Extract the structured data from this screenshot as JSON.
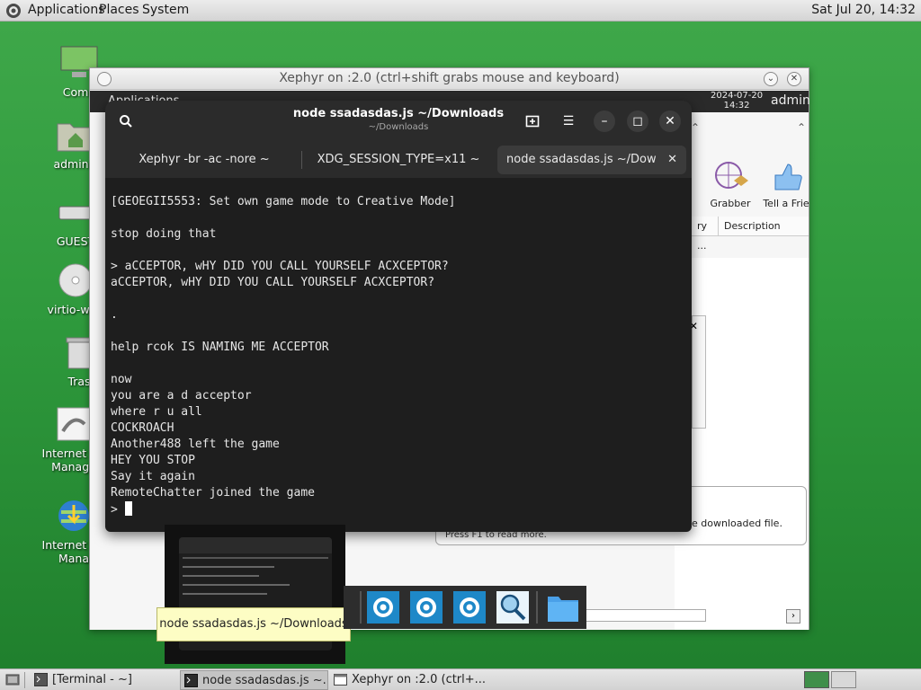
{
  "top_panel": {
    "menus": [
      "Applications",
      "Places",
      "System"
    ],
    "clock": "Sat Jul 20, 14:32"
  },
  "desktop_icons": [
    {
      "label": "Comp"
    },
    {
      "label": "admin's"
    },
    {
      "label": "GUEST"
    },
    {
      "label": "virtio-win-"
    },
    {
      "label": "Tras"
    },
    {
      "label": "Internet Do\nManage"
    },
    {
      "label": "Internet Do\nMana"
    }
  ],
  "xephyr": {
    "title": "Xephyr on :2.0 (ctrl+shift grabs mouse and keyboard)",
    "inner_panel": {
      "applications": "Applications",
      "clock_date": "2024-07-20",
      "clock_time": "14:32",
      "user": "admin"
    },
    "toolbar": {
      "grabber": "Grabber",
      "tell_friend": "Tell a Frie"
    },
    "columns": [
      "ry ...",
      "Description"
    ],
    "status_text": "e downloaded file.",
    "hint_text": "Press F1 to read more."
  },
  "terminal": {
    "title": "node ssadasdas.js ~/Downloads",
    "subtitle": "~/Downloads",
    "tabs": [
      {
        "label": "Xephyr -br -ac -nore ~"
      },
      {
        "label": "XDG_SESSION_TYPE=x11 ~"
      },
      {
        "label": "node ssadasdas.js ~/Downlo"
      }
    ],
    "lines": [
      "[GEOEGII5553: Set own game mode to Creative Mode]",
      "",
      "stop doing that",
      "",
      "> aCCEPTOR, wHY DID YOU CALL YOURSELF ACXCEPTOR?",
      "aCCEPTOR, wHY DID YOU CALL YOURSELF ACXCEPTOR?",
      "",
      ".",
      "",
      "help rcok IS NAMING ME ACCEPTOR",
      "",
      "now",
      "you are a d acceptor",
      "where r u all",
      "COCKROACH",
      "Another488 left the game",
      "HEY YOU STOP",
      "Say it again",
      "RemoteChatter joined the game"
    ],
    "prompt": "> "
  },
  "tooltip": "node ssadasdas.js ~/Downloads",
  "taskbar": {
    "items": [
      {
        "label": "[Terminal - ~]"
      },
      {
        "label": "node ssadasdas.js ~..."
      },
      {
        "label": "Xephyr on :2.0 (ctrl+..."
      }
    ]
  },
  "colors": {
    "desktop_green": "#2f9a3d",
    "terminal_bg": "#1e1e1e",
    "terminal_header": "#2b2b2b",
    "tooltip_bg": "#fdfdc4",
    "dock_blue": "#1e88c8"
  }
}
